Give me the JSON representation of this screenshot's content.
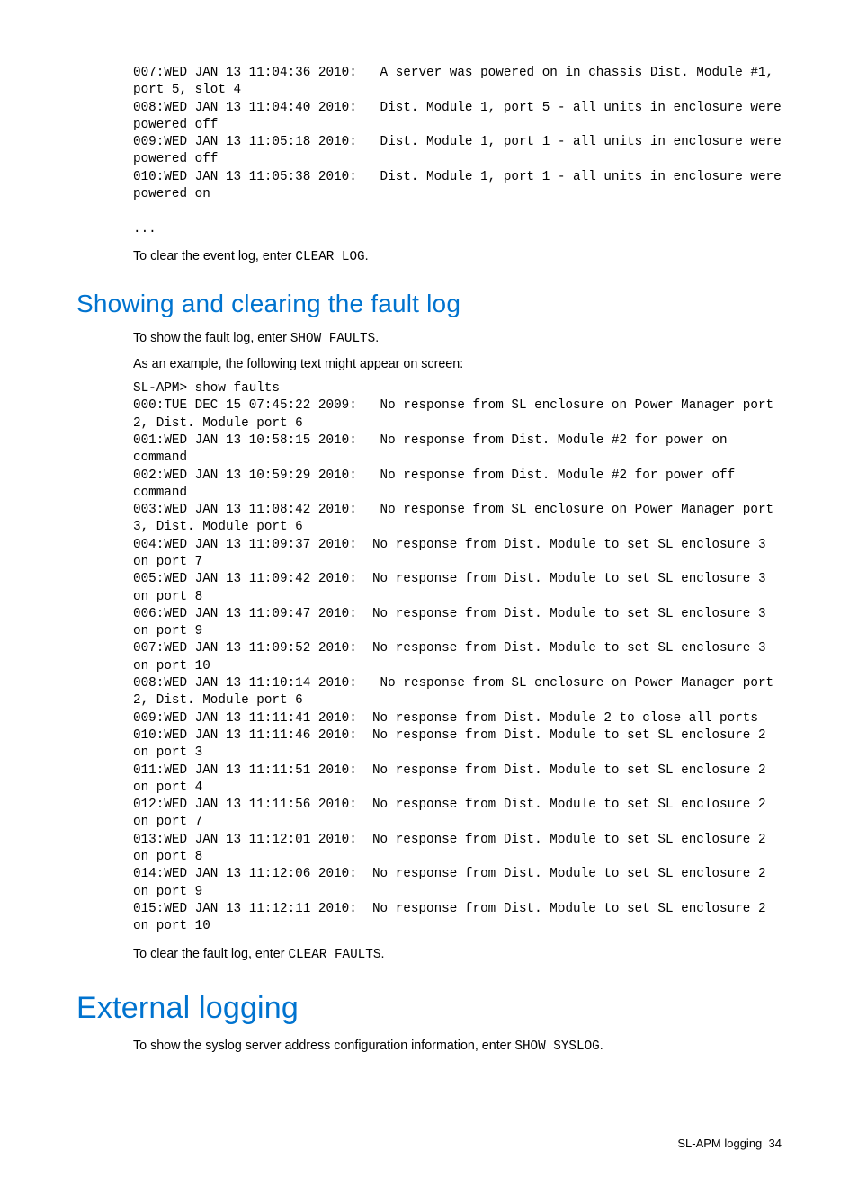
{
  "eventLogTail": "007:WED JAN 13 11:04:36 2010:   A server was powered on in chassis Dist. Module #1, port 5, slot 4\n008:WED JAN 13 11:04:40 2010:   Dist. Module 1, port 5 - all units in enclosure were powered off\n009:WED JAN 13 11:05:18 2010:   Dist. Module 1, port 1 - all units in enclosure were powered off\n010:WED JAN 13 11:05:38 2010:   Dist. Module 1, port 1 - all units in enclosure were powered on\n\n...",
  "clearEvent": {
    "lead": "To clear the event log, enter ",
    "cmd": "CLEAR LOG",
    "tail": "."
  },
  "faultHeading": "Showing and clearing the fault log",
  "showFault": {
    "lead": "To show the fault log, enter ",
    "cmd": "SHOW FAULTS",
    "tail": "."
  },
  "exampleIntro": "As an example, the following text might appear on screen:",
  "faultDump": "SL-APM> show faults\n000:TUE DEC 15 07:45:22 2009:   No response from SL enclosure on Power Manager port 2, Dist. Module port 6\n001:WED JAN 13 10:58:15 2010:   No response from Dist. Module #2 for power on command\n002:WED JAN 13 10:59:29 2010:   No response from Dist. Module #2 for power off command\n003:WED JAN 13 11:08:42 2010:   No response from SL enclosure on Power Manager port 3, Dist. Module port 6\n004:WED JAN 13 11:09:37 2010:  No response from Dist. Module to set SL enclosure 3 on port 7\n005:WED JAN 13 11:09:42 2010:  No response from Dist. Module to set SL enclosure 3 on port 8\n006:WED JAN 13 11:09:47 2010:  No response from Dist. Module to set SL enclosure 3 on port 9\n007:WED JAN 13 11:09:52 2010:  No response from Dist. Module to set SL enclosure 3 on port 10\n008:WED JAN 13 11:10:14 2010:   No response from SL enclosure on Power Manager port 2, Dist. Module port 6\n009:WED JAN 13 11:11:41 2010:  No response from Dist. Module 2 to close all ports\n010:WED JAN 13 11:11:46 2010:  No response from Dist. Module to set SL enclosure 2 on port 3\n011:WED JAN 13 11:11:51 2010:  No response from Dist. Module to set SL enclosure 2 on port 4\n012:WED JAN 13 11:11:56 2010:  No response from Dist. Module to set SL enclosure 2 on port 7\n013:WED JAN 13 11:12:01 2010:  No response from Dist. Module to set SL enclosure 2 on port 8\n014:WED JAN 13 11:12:06 2010:  No response from Dist. Module to set SL enclosure 2 on port 9\n015:WED JAN 13 11:12:11 2010:  No response from Dist. Module to set SL enclosure 2 on port 10",
  "clearFault": {
    "lead": "To clear the fault log, enter ",
    "cmd": "CLEAR FAULTS",
    "tail": "."
  },
  "externalHeading": "External logging",
  "syslog": {
    "lead": "To show the syslog server address configuration information, enter ",
    "cmd": "SHOW SYSLOG",
    "tail": "."
  },
  "footer": {
    "section": "SL-APM logging",
    "page": "34"
  }
}
